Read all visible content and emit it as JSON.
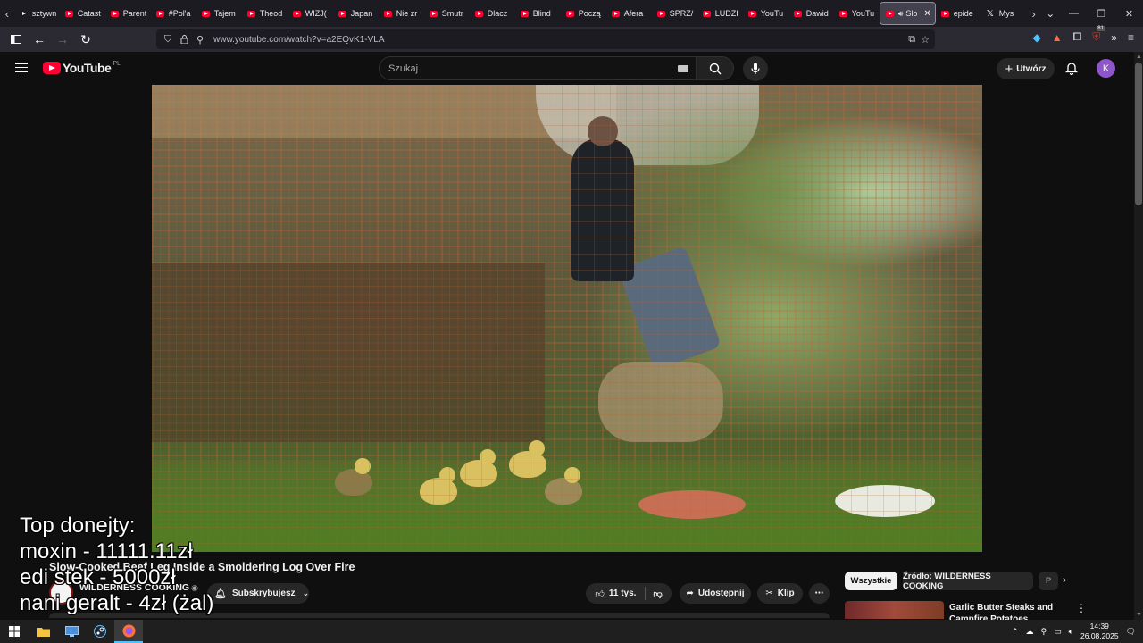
{
  "browser": {
    "tabs": [
      {
        "label": "sztywn",
        "icon": "document-icon"
      },
      {
        "label": "Catast",
        "icon": "youtube-icon"
      },
      {
        "label": "Parent",
        "icon": "youtube-icon"
      },
      {
        "label": "#Pol'a",
        "icon": "youtube-icon"
      },
      {
        "label": "Tajem",
        "icon": "youtube-icon"
      },
      {
        "label": "Theod",
        "icon": "youtube-icon"
      },
      {
        "label": "WIZJ(",
        "icon": "youtube-icon"
      },
      {
        "label": "Japan",
        "icon": "youtube-icon"
      },
      {
        "label": "Nie zr",
        "icon": "youtube-icon"
      },
      {
        "label": "Smutr",
        "icon": "youtube-icon"
      },
      {
        "label": "Dlacz",
        "icon": "youtube-icon"
      },
      {
        "label": "Blind",
        "icon": "youtube-icon"
      },
      {
        "label": "Począ",
        "icon": "youtube-icon"
      },
      {
        "label": "Afera",
        "icon": "youtube-icon"
      },
      {
        "label": "SPRZ/",
        "icon": "youtube-icon"
      },
      {
        "label": "LUDZI",
        "icon": "youtube-icon"
      },
      {
        "label": "YouTu",
        "icon": "youtube-icon"
      },
      {
        "label": "Dawid",
        "icon": "youtube-icon"
      },
      {
        "label": "YouTu",
        "icon": "youtube-icon"
      }
    ],
    "active_tab": {
      "label": "Slo",
      "icon": "youtube-icon",
      "audio": true
    },
    "tabs_after": [
      {
        "label": "epide",
        "icon": "youtube-icon"
      },
      {
        "label": "Mys",
        "icon": "x-icon"
      }
    ],
    "url": "www.youtube.com/watch?v=a2EQvK1-VLA",
    "extension_badge": "81"
  },
  "youtube": {
    "logo_text": "YouTube",
    "logo_country": "PL",
    "search_placeholder": "Szukaj",
    "create_label": "Utwórz",
    "avatar_letter": "K"
  },
  "overlay": {
    "lines": [
      "Top donejty:",
      "moxin - 11111.11zł",
      "edi stek - 5000zł",
      "nani geralt - 4zł (żal)"
    ]
  },
  "video": {
    "title": "Slow-Cooked Beef Leg Inside a Smoldering Log Over Fire",
    "channel": "WILDERNESS COOKING",
    "subscribe_label": "Subskrybujesz",
    "likes": "11 tys.",
    "share_label": "Udostępnij",
    "clip_label": "Klip"
  },
  "sidebar": {
    "chips": [
      {
        "label": "Wszystkie",
        "selected": true
      },
      {
        "label": "Źródło: WILDERNESS COOKING",
        "selected": false
      },
      {
        "label": "P",
        "selected": false
      }
    ],
    "recommendation": {
      "title": "Garlic Butter Steaks and Campfire Potatoes Outdoors"
    }
  },
  "taskbar": {
    "time": "14:39",
    "date": "26.08.2025"
  },
  "colors": {
    "youtube_red": "#ff0033",
    "avatar_purple": "#8e56c9",
    "background": "#0f0f0f"
  }
}
